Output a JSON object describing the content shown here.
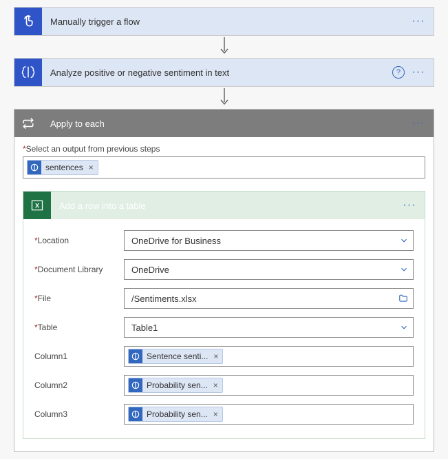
{
  "step1": {
    "title": "Manually trigger a flow"
  },
  "step2": {
    "title": "Analyze positive or negative sentiment in text"
  },
  "applyEach": {
    "title": "Apply to each",
    "outputLabel": "Select an output from previous steps",
    "outputToken": "sentences"
  },
  "addRow": {
    "title": "Add a row into a table",
    "fields": {
      "location": {
        "label": "Location",
        "value": "OneDrive for Business",
        "required": true,
        "kind": "select"
      },
      "library": {
        "label": "Document Library",
        "value": "OneDrive",
        "required": true,
        "kind": "select"
      },
      "file": {
        "label": "File",
        "value": "/Sentiments.xlsx",
        "required": true,
        "kind": "file"
      },
      "table": {
        "label": "Table",
        "value": "Table1",
        "required": true,
        "kind": "select"
      },
      "col1": {
        "label": "Column1",
        "token": "Sentence senti...",
        "required": false
      },
      "col2": {
        "label": "Column2",
        "token": "Probability sen...",
        "required": false
      },
      "col3": {
        "label": "Column3",
        "token": "Probability sen...",
        "required": false
      }
    }
  }
}
